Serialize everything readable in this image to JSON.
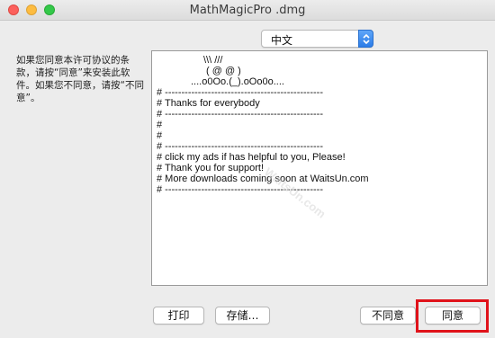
{
  "window": {
    "title": "MathMagicPro .dmg"
  },
  "language_select": {
    "value": "中文"
  },
  "instructions": {
    "text": "如果您同意本许可协议的条款，请按“同意”来安装此软件。如果您不同意，请按“不同意”。"
  },
  "license": {
    "lines": [
      "\\\\\\ ///",
      "( @ @ )",
      "....o0Oo.(_).oOo0o....",
      "# ------------------------------------------------",
      "# Thanks for everybody",
      "# ------------------------------------------------",
      "#",
      "#",
      "# ------------------------------------------------",
      "# click my ads if has helpful to you, Please!",
      "# Thank you for support!",
      "# More downloads coming soon at WaitsUn.com",
      "# ------------------------------------------------"
    ],
    "watermark": "WaitsUn.com"
  },
  "buttons": {
    "print": "打印",
    "save": "存储…",
    "disagree": "不同意",
    "agree": "同意"
  },
  "colors": {
    "highlight": "#e0131b",
    "select_accent": "#2b7ce8"
  }
}
